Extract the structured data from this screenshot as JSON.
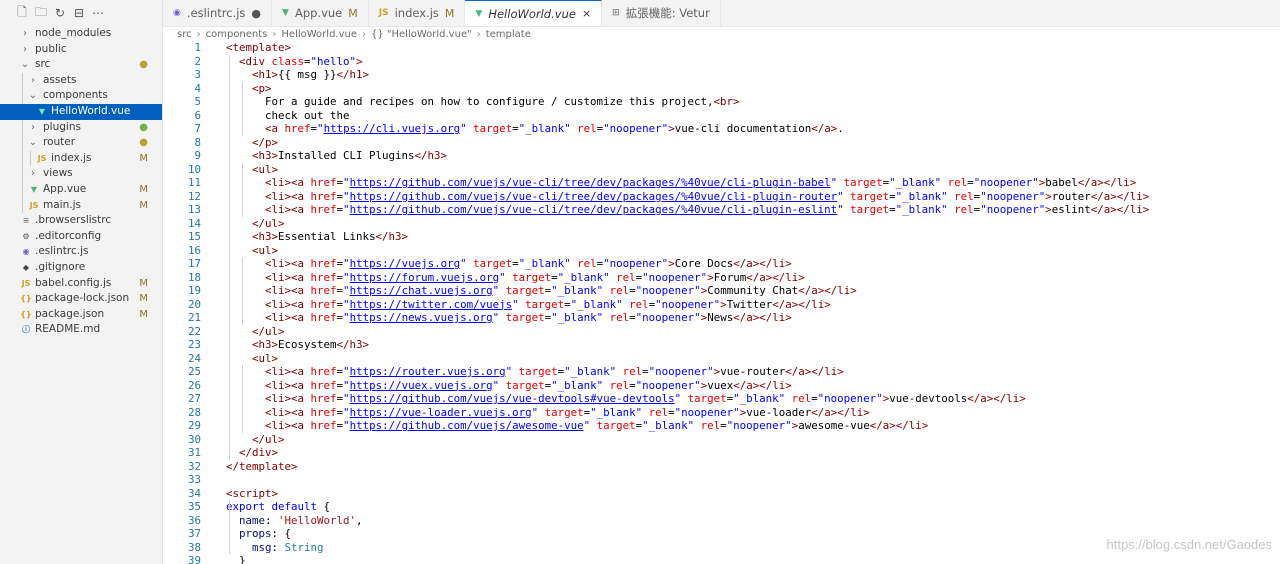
{
  "explorer": {
    "toolbar_icons": [
      "new-file-icon",
      "new-folder-icon",
      "refresh-icon",
      "collapse-icon",
      "more-icon"
    ],
    "items": [
      {
        "label": "node_modules",
        "type": "folder",
        "open": false,
        "depth": 0
      },
      {
        "label": "public",
        "type": "folder",
        "open": false,
        "depth": 0
      },
      {
        "label": "src",
        "type": "folder",
        "open": true,
        "depth": 0,
        "mark": "●",
        "mark_color": "#b6a234"
      },
      {
        "label": "assets",
        "type": "folder",
        "open": false,
        "depth": 1
      },
      {
        "label": "components",
        "type": "folder",
        "open": true,
        "depth": 1
      },
      {
        "label": "HelloWorld.vue",
        "type": "vue",
        "depth": 2,
        "selected": true
      },
      {
        "label": "plugins",
        "type": "folder",
        "open": false,
        "depth": 1,
        "mark": "●",
        "mark_color": "#74b04c"
      },
      {
        "label": "router",
        "type": "folder",
        "open": true,
        "depth": 1,
        "mark": "●",
        "mark_color": "#b6a234"
      },
      {
        "label": "index.js",
        "type": "js",
        "depth": 2,
        "mark": "M",
        "mark_color": "#8a7425"
      },
      {
        "label": "views",
        "type": "folder",
        "open": false,
        "depth": 1
      },
      {
        "label": "App.vue",
        "type": "vue",
        "depth": 1,
        "mark": "M",
        "mark_color": "#8a7425"
      },
      {
        "label": "main.js",
        "type": "js",
        "depth": 1,
        "mark": "M",
        "mark_color": "#8a7425"
      },
      {
        "label": ".browserslistrc",
        "type": "text",
        "depth": 0
      },
      {
        "label": ".editorconfig",
        "type": "gear",
        "depth": 0
      },
      {
        "label": ".eslintrc.js",
        "type": "eslint",
        "depth": 0
      },
      {
        "label": ".gitignore",
        "type": "git",
        "depth": 0
      },
      {
        "label": "babel.config.js",
        "type": "js",
        "depth": 0,
        "mark": "M",
        "mark_color": "#8a7425"
      },
      {
        "label": "package-lock.json",
        "type": "json",
        "depth": 0,
        "mark": "M",
        "mark_color": "#8a7425"
      },
      {
        "label": "package.json",
        "type": "json",
        "depth": 0,
        "mark": "M",
        "mark_color": "#8a7425"
      },
      {
        "label": "README.md",
        "type": "info",
        "depth": 0
      }
    ]
  },
  "tabs": [
    {
      "label": ".eslintrc.js",
      "icon": "eslint",
      "status": "●",
      "active": false
    },
    {
      "label": "App.vue",
      "icon": "vue",
      "status": "M",
      "active": false
    },
    {
      "label": "index.js",
      "icon": "js",
      "status": "M",
      "active": false
    },
    {
      "label": "HelloWorld.vue",
      "icon": "vue",
      "status": "×",
      "active": true
    },
    {
      "label": "拡張機能: Vetur",
      "icon": "extension",
      "status": "",
      "active": false
    }
  ],
  "breadcrumb": [
    "src",
    "components",
    "HelloWorld.vue",
    "{} \"HelloWorld.vue\"",
    "template"
  ],
  "code": [
    [
      [
        "p",
        "<template>"
      ]
    ],
    [
      [
        "p",
        "  <div "
      ],
      [
        "a",
        "class"
      ],
      [
        "t",
        "="
      ],
      [
        "s",
        "\"hello\""
      ],
      [
        "p",
        ">"
      ]
    ],
    [
      [
        "p",
        "    <h1>"
      ],
      [
        "t",
        "{{ msg }}"
      ],
      [
        "p",
        "</h1>"
      ]
    ],
    [
      [
        "p",
        "    <p>"
      ]
    ],
    [
      [
        "t",
        "      For a guide and recipes on how to configure / customize this project,"
      ],
      [
        "p",
        "<br>"
      ]
    ],
    [
      [
        "t",
        "      check out the"
      ]
    ],
    [
      [
        "p",
        "      <a "
      ],
      [
        "a",
        "href"
      ],
      [
        "t",
        "="
      ],
      [
        "s",
        "\""
      ],
      [
        "u",
        "https://cli.vuejs.org"
      ],
      [
        "s",
        "\""
      ],
      [
        "a",
        " target"
      ],
      [
        "t",
        "="
      ],
      [
        "s",
        "\"_blank\""
      ],
      [
        "a",
        " rel"
      ],
      [
        "t",
        "="
      ],
      [
        "s",
        "\"noopener\""
      ],
      [
        "p",
        ">"
      ],
      [
        "t",
        "vue-cli documentation"
      ],
      [
        "p",
        "</a>"
      ],
      [
        "t",
        "."
      ]
    ],
    [
      [
        "p",
        "    </p>"
      ]
    ],
    [
      [
        "p",
        "    <h3>"
      ],
      [
        "t",
        "Installed CLI Plugins"
      ],
      [
        "p",
        "</h3>"
      ]
    ],
    [
      [
        "p",
        "    <ul>"
      ]
    ],
    [
      [
        "p",
        "      <li><a "
      ],
      [
        "a",
        "href"
      ],
      [
        "t",
        "="
      ],
      [
        "s",
        "\""
      ],
      [
        "u",
        "https://github.com/vuejs/vue-cli/tree/dev/packages/%40vue/cli-plugin-babel"
      ],
      [
        "s",
        "\""
      ],
      [
        "a",
        " target"
      ],
      [
        "t",
        "="
      ],
      [
        "s",
        "\"_blank\""
      ],
      [
        "a",
        " rel"
      ],
      [
        "t",
        "="
      ],
      [
        "s",
        "\"noopener\""
      ],
      [
        "p",
        ">"
      ],
      [
        "t",
        "babel"
      ],
      [
        "p",
        "</a></li>"
      ]
    ],
    [
      [
        "p",
        "      <li><a "
      ],
      [
        "a",
        "href"
      ],
      [
        "t",
        "="
      ],
      [
        "s",
        "\""
      ],
      [
        "u",
        "https://github.com/vuejs/vue-cli/tree/dev/packages/%40vue/cli-plugin-router"
      ],
      [
        "s",
        "\""
      ],
      [
        "a",
        " target"
      ],
      [
        "t",
        "="
      ],
      [
        "s",
        "\"_blank\""
      ],
      [
        "a",
        " rel"
      ],
      [
        "t",
        "="
      ],
      [
        "s",
        "\"noopener\""
      ],
      [
        "p",
        ">"
      ],
      [
        "t",
        "router"
      ],
      [
        "p",
        "</a></li>"
      ]
    ],
    [
      [
        "p",
        "      <li><a "
      ],
      [
        "a",
        "href"
      ],
      [
        "t",
        "="
      ],
      [
        "s",
        "\""
      ],
      [
        "u",
        "https://github.com/vuejs/vue-cli/tree/dev/packages/%40vue/cli-plugin-eslint"
      ],
      [
        "s",
        "\""
      ],
      [
        "a",
        " target"
      ],
      [
        "t",
        "="
      ],
      [
        "s",
        "\"_blank\""
      ],
      [
        "a",
        " rel"
      ],
      [
        "t",
        "="
      ],
      [
        "s",
        "\"noopener\""
      ],
      [
        "p",
        ">"
      ],
      [
        "t",
        "eslint"
      ],
      [
        "p",
        "</a></li>"
      ]
    ],
    [
      [
        "p",
        "    </ul>"
      ]
    ],
    [
      [
        "p",
        "    <h3>"
      ],
      [
        "t",
        "Essential Links"
      ],
      [
        "p",
        "</h3>"
      ]
    ],
    [
      [
        "p",
        "    <ul>"
      ]
    ],
    [
      [
        "p",
        "      <li><a "
      ],
      [
        "a",
        "href"
      ],
      [
        "t",
        "="
      ],
      [
        "s",
        "\""
      ],
      [
        "u",
        "https://vuejs.org"
      ],
      [
        "s",
        "\""
      ],
      [
        "a",
        " target"
      ],
      [
        "t",
        "="
      ],
      [
        "s",
        "\"_blank\""
      ],
      [
        "a",
        " rel"
      ],
      [
        "t",
        "="
      ],
      [
        "s",
        "\"noopener\""
      ],
      [
        "p",
        ">"
      ],
      [
        "t",
        "Core Docs"
      ],
      [
        "p",
        "</a></li>"
      ]
    ],
    [
      [
        "p",
        "      <li><a "
      ],
      [
        "a",
        "href"
      ],
      [
        "t",
        "="
      ],
      [
        "s",
        "\""
      ],
      [
        "u",
        "https://forum.vuejs.org"
      ],
      [
        "s",
        "\""
      ],
      [
        "a",
        " target"
      ],
      [
        "t",
        "="
      ],
      [
        "s",
        "\"_blank\""
      ],
      [
        "a",
        " rel"
      ],
      [
        "t",
        "="
      ],
      [
        "s",
        "\"noopener\""
      ],
      [
        "p",
        ">"
      ],
      [
        "t",
        "Forum"
      ],
      [
        "p",
        "</a></li>"
      ]
    ],
    [
      [
        "p",
        "      <li><a "
      ],
      [
        "a",
        "href"
      ],
      [
        "t",
        "="
      ],
      [
        "s",
        "\""
      ],
      [
        "u",
        "https://chat.vuejs.org"
      ],
      [
        "s",
        "\""
      ],
      [
        "a",
        " target"
      ],
      [
        "t",
        "="
      ],
      [
        "s",
        "\"_blank\""
      ],
      [
        "a",
        " rel"
      ],
      [
        "t",
        "="
      ],
      [
        "s",
        "\"noopener\""
      ],
      [
        "p",
        ">"
      ],
      [
        "t",
        "Community Chat"
      ],
      [
        "p",
        "</a></li>"
      ]
    ],
    [
      [
        "p",
        "      <li><a "
      ],
      [
        "a",
        "href"
      ],
      [
        "t",
        "="
      ],
      [
        "s",
        "\""
      ],
      [
        "u",
        "https://twitter.com/vuejs"
      ],
      [
        "s",
        "\""
      ],
      [
        "a",
        " target"
      ],
      [
        "t",
        "="
      ],
      [
        "s",
        "\"_blank\""
      ],
      [
        "a",
        " rel"
      ],
      [
        "t",
        "="
      ],
      [
        "s",
        "\"noopener\""
      ],
      [
        "p",
        ">"
      ],
      [
        "t",
        "Twitter"
      ],
      [
        "p",
        "</a></li>"
      ]
    ],
    [
      [
        "p",
        "      <li><a "
      ],
      [
        "a",
        "href"
      ],
      [
        "t",
        "="
      ],
      [
        "s",
        "\""
      ],
      [
        "u",
        "https://news.vuejs.org"
      ],
      [
        "s",
        "\""
      ],
      [
        "a",
        " target"
      ],
      [
        "t",
        "="
      ],
      [
        "s",
        "\"_blank\""
      ],
      [
        "a",
        " rel"
      ],
      [
        "t",
        "="
      ],
      [
        "s",
        "\"noopener\""
      ],
      [
        "p",
        ">"
      ],
      [
        "t",
        "News"
      ],
      [
        "p",
        "</a></li>"
      ]
    ],
    [
      [
        "p",
        "    </ul>"
      ]
    ],
    [
      [
        "p",
        "    <h3>"
      ],
      [
        "t",
        "Ecosystem"
      ],
      [
        "p",
        "</h3>"
      ]
    ],
    [
      [
        "p",
        "    <ul>"
      ]
    ],
    [
      [
        "p",
        "      <li><a "
      ],
      [
        "a",
        "href"
      ],
      [
        "t",
        "="
      ],
      [
        "s",
        "\""
      ],
      [
        "u",
        "https://router.vuejs.org"
      ],
      [
        "s",
        "\""
      ],
      [
        "a",
        " target"
      ],
      [
        "t",
        "="
      ],
      [
        "s",
        "\"_blank\""
      ],
      [
        "a",
        " rel"
      ],
      [
        "t",
        "="
      ],
      [
        "s",
        "\"noopener\""
      ],
      [
        "p",
        ">"
      ],
      [
        "t",
        "vue-router"
      ],
      [
        "p",
        "</a></li>"
      ]
    ],
    [
      [
        "p",
        "      <li><a "
      ],
      [
        "a",
        "href"
      ],
      [
        "t",
        "="
      ],
      [
        "s",
        "\""
      ],
      [
        "u",
        "https://vuex.vuejs.org"
      ],
      [
        "s",
        "\""
      ],
      [
        "a",
        " target"
      ],
      [
        "t",
        "="
      ],
      [
        "s",
        "\"_blank\""
      ],
      [
        "a",
        " rel"
      ],
      [
        "t",
        "="
      ],
      [
        "s",
        "\"noopener\""
      ],
      [
        "p",
        ">"
      ],
      [
        "t",
        "vuex"
      ],
      [
        "p",
        "</a></li>"
      ]
    ],
    [
      [
        "p",
        "      <li><a "
      ],
      [
        "a",
        "href"
      ],
      [
        "t",
        "="
      ],
      [
        "s",
        "\""
      ],
      [
        "u",
        "https://github.com/vuejs/vue-devtools#vue-devtools"
      ],
      [
        "s",
        "\""
      ],
      [
        "a",
        " target"
      ],
      [
        "t",
        "="
      ],
      [
        "s",
        "\"_blank\""
      ],
      [
        "a",
        " rel"
      ],
      [
        "t",
        "="
      ],
      [
        "s",
        "\"noopener\""
      ],
      [
        "p",
        ">"
      ],
      [
        "t",
        "vue-devtools"
      ],
      [
        "p",
        "</a></li>"
      ]
    ],
    [
      [
        "p",
        "      <li><a "
      ],
      [
        "a",
        "href"
      ],
      [
        "t",
        "="
      ],
      [
        "s",
        "\""
      ],
      [
        "u",
        "https://vue-loader.vuejs.org"
      ],
      [
        "s",
        "\""
      ],
      [
        "a",
        " target"
      ],
      [
        "t",
        "="
      ],
      [
        "s",
        "\"_blank\""
      ],
      [
        "a",
        " rel"
      ],
      [
        "t",
        "="
      ],
      [
        "s",
        "\"noopener\""
      ],
      [
        "p",
        ">"
      ],
      [
        "t",
        "vue-loader"
      ],
      [
        "p",
        "</a></li>"
      ]
    ],
    [
      [
        "p",
        "      <li><a "
      ],
      [
        "a",
        "href"
      ],
      [
        "t",
        "="
      ],
      [
        "s",
        "\""
      ],
      [
        "u",
        "https://github.com/vuejs/awesome-vue"
      ],
      [
        "s",
        "\""
      ],
      [
        "a",
        " target"
      ],
      [
        "t",
        "="
      ],
      [
        "s",
        "\"_blank\""
      ],
      [
        "a",
        " rel"
      ],
      [
        "t",
        "="
      ],
      [
        "s",
        "\"noopener\""
      ],
      [
        "p",
        ">"
      ],
      [
        "t",
        "awesome-vue"
      ],
      [
        "p",
        "</a></li>"
      ]
    ],
    [
      [
        "p",
        "    </ul>"
      ]
    ],
    [
      [
        "p",
        "  </div>"
      ]
    ],
    [
      [
        "p",
        "</template>"
      ]
    ],
    [],
    [
      [
        "p",
        "<script>"
      ]
    ],
    [
      [
        "k",
        "export default"
      ],
      [
        "t",
        " {"
      ]
    ],
    [
      [
        "id",
        "  name"
      ],
      [
        "t",
        ": "
      ],
      [
        "js",
        "'HelloWorld'"
      ],
      [
        "t",
        ","
      ]
    ],
    [
      [
        "id",
        "  props"
      ],
      [
        "t",
        ": {"
      ]
    ],
    [
      [
        "id",
        "    msg"
      ],
      [
        "t",
        ": "
      ],
      [
        "ty",
        "String"
      ]
    ],
    [
      [
        "t",
        "  }"
      ]
    ]
  ],
  "watermark": "https://blog.csdn.net/Gaodes"
}
